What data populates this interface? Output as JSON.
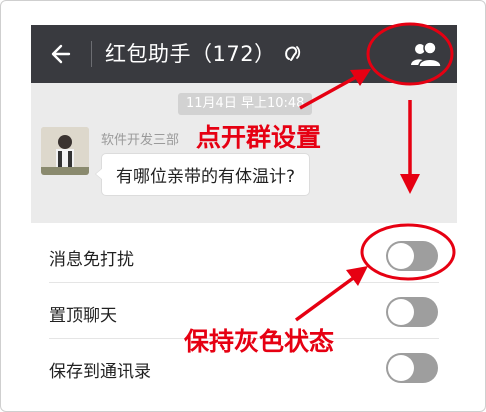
{
  "header": {
    "title": "红包助手（172）",
    "back_icon": "back-arrow-icon",
    "ear_icon": "earpiece-icon",
    "members_icon": "group-members-icon"
  },
  "chat": {
    "timestamp": "11月4日 早上10:48",
    "sender": "软件开发三部",
    "message": "有哪位亲带的有体温计?"
  },
  "settings": [
    {
      "label": "消息免打扰",
      "toggle": false
    },
    {
      "label": "置顶聊天",
      "toggle": false
    },
    {
      "label": "保存到通讯录",
      "toggle": false
    }
  ],
  "annotations": {
    "group_settings": "点开群设置",
    "keep_gray": "保持灰色状态",
    "color": "#e60012"
  }
}
